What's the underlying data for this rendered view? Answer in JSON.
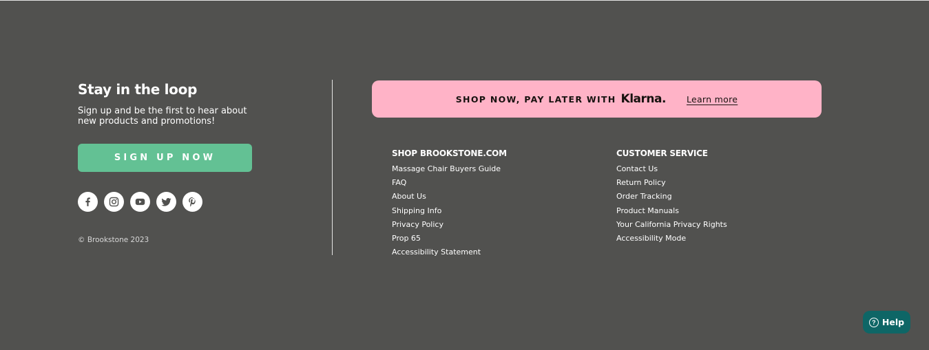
{
  "newsletter": {
    "heading": "Stay in the loop",
    "subtext": "Sign up and be the first to hear about new products and promotions!",
    "button_label": "SIGN UP NOW"
  },
  "social": [
    {
      "name": "facebook-icon"
    },
    {
      "name": "instagram-icon"
    },
    {
      "name": "youtube-icon"
    },
    {
      "name": "twitter-icon"
    },
    {
      "name": "pinterest-icon"
    }
  ],
  "copyright": "© Brookstone 2023",
  "klarna": {
    "text": "SHOP NOW, PAY LATER WITH",
    "logo": "Klarna.",
    "link": "Learn more"
  },
  "shop": {
    "heading": "SHOP BROOKSTONE.COM",
    "links": [
      "Massage Chair Buyers Guide",
      "FAQ",
      "About Us",
      "Shipping Info",
      "Privacy Policy",
      "Prop 65",
      "Accessibility Statement"
    ]
  },
  "service": {
    "heading": "CUSTOMER SERVICE",
    "links": [
      "Contact Us",
      "Return Policy",
      "Order Tracking",
      "Product Manuals",
      "Your California Privacy Rights",
      "Accessibility Mode"
    ]
  },
  "help": {
    "label": "Help",
    "icon": "?"
  },
  "colors": {
    "background": "#51514f",
    "signup": "#63c194",
    "klarna_bg": "#ffb3c7",
    "help_bg": "#0e6666"
  }
}
